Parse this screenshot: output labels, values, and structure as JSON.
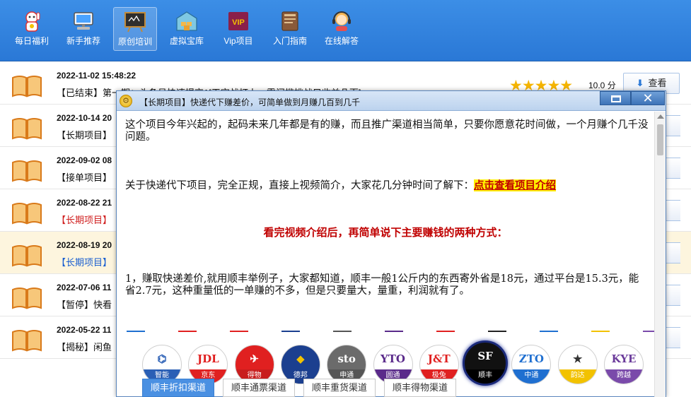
{
  "toolbar": {
    "items": [
      {
        "label": "每日福利",
        "icon": "lucky-cat-icon"
      },
      {
        "label": "新手推荐",
        "icon": "computer-icon"
      },
      {
        "label": "原创培训",
        "icon": "blackboard-icon",
        "active": true
      },
      {
        "label": "虚拟宝库",
        "icon": "warehouse-icon"
      },
      {
        "label": "Vip项目",
        "icon": "vip-icon",
        "badge": "VIP"
      },
      {
        "label": "入门指南",
        "icon": "book-guide-icon"
      },
      {
        "label": "在线解答",
        "icon": "support-agent-icon"
      }
    ]
  },
  "list": {
    "rows": [
      {
        "date": "2022-11-02 15:48:22",
        "title": "【已结束】第一期：头条号快速提交1[天空战打上一零门槛挑战只收益几百]",
        "style": "normal",
        "score": "10.0 分",
        "view_label": "查看"
      },
      {
        "date": "2022-10-14 20",
        "title": "【长期项目】",
        "style": "normal"
      },
      {
        "date": "2022-09-02 08",
        "title": "【接单项目】",
        "style": "normal"
      },
      {
        "date": "2022-08-22 21",
        "title": "【长期项目】",
        "style": "red"
      },
      {
        "date": "2022-08-19 20",
        "title": "【长期项目】",
        "style": "blue",
        "highlight": true
      },
      {
        "date": "2022-07-06 11",
        "title": "【暂停】快看",
        "style": "normal"
      },
      {
        "date": "2022-05-22 11",
        "title": "【揭秘】闲鱼",
        "style": "normal"
      }
    ]
  },
  "dialog": {
    "caption": "【长期项目】快递代下赚差价，可简单做到月赚几百到几千",
    "p1": "这个项目今年兴起的，起码未来几年都是有的赚，而且推广渠道相当简单，只要你愿意花时间做，一个月赚个几千没问题。",
    "p2_text": "关于快递代下项目，完全正规，直接上视频简介，大家花几分钟时间了解下：",
    "p2_link": "点击查看项目介绍",
    "p3": "看完视频介绍后，再简单说下主要赚钱的两种方式：",
    "p4": "1，赚取快递差价,就用顺丰举例子，大家都知道，顺丰一般1公斤内的东西寄外省是18元，通过平台是15.3元，能省2.7元，这种重量低的一单赚的不多，但是只要量大，量重，利润就有了。",
    "couriers": [
      {
        "top": "⌬",
        "name": "智能",
        "color": "#2a5fb5",
        "bottom_color": "#2a5fb5"
      },
      {
        "top": "JDL",
        "name": "京东",
        "color": "#e02020",
        "bottom_color": "#e02020"
      },
      {
        "top": "✈",
        "name": "得物",
        "color": "#ffffff",
        "bottom_color": "#c81e1e",
        "bg": "#e02020"
      },
      {
        "top": "◆",
        "name": "德邦",
        "color": "#f2c200",
        "bottom_color": "#1b3f8f",
        "bg": "#1b3f8f"
      },
      {
        "top": "sto",
        "name": "申通",
        "color": "#ffffff",
        "bottom_color": "#555555",
        "bg": "#6b6b6b"
      },
      {
        "top": "YTO",
        "name": "圆通",
        "color": "#5a2a8a",
        "bottom_color": "#5a2a8a"
      },
      {
        "top": "J&T",
        "name": "极兔",
        "color": "#e02020",
        "bottom_color": "#e02020"
      },
      {
        "top": "SF",
        "name": "顺丰",
        "color": "#ffffff",
        "bottom_color": "#000000",
        "bg": "#111111",
        "selected": true
      },
      {
        "top": "ZTO",
        "name": "中通",
        "color": "#1f6fd0",
        "bottom_color": "#1f6fd0"
      },
      {
        "top": "★",
        "name": "韵达",
        "color": "#333333",
        "bottom_color": "#f2c200"
      },
      {
        "top": "KYE",
        "name": "跨越",
        "color": "#6a3a9a",
        "bottom_color": "#7a4aaa"
      }
    ],
    "dash_colors": [
      "#1f6fd0",
      "#e02020",
      "#e02020",
      "#1b3f8f",
      "#555555",
      "#5a2a8a",
      "#e02020",
      "#222222",
      "#1f6fd0",
      "#f2c200",
      "#7a4aaa"
    ],
    "tabs": [
      {
        "label": "顺丰折扣渠道",
        "active": true
      },
      {
        "label": "顺丰通票渠道"
      },
      {
        "label": "顺丰重货渠道"
      },
      {
        "label": "顺丰得物渠道"
      }
    ]
  }
}
